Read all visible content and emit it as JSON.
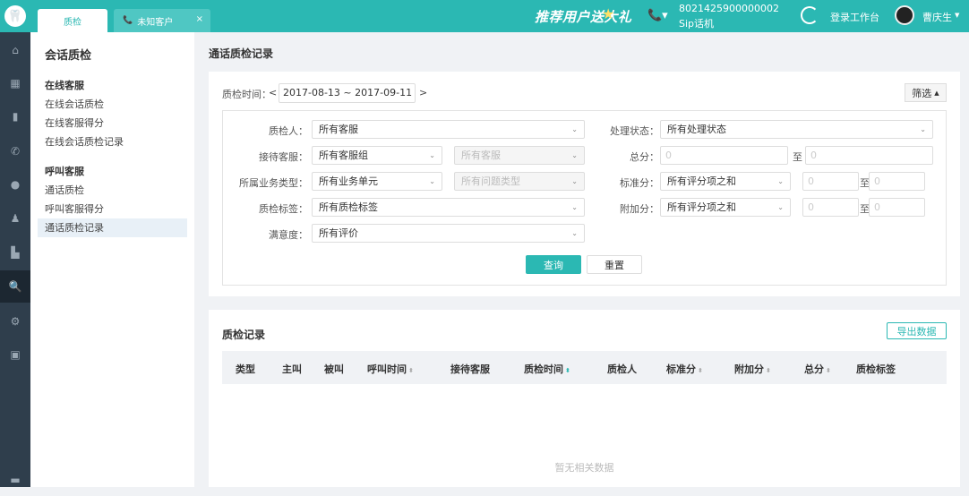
{
  "topbar": {
    "tabs": [
      {
        "label": "质检"
      },
      {
        "label": "未知客户",
        "close": "×"
      }
    ],
    "promo": "推荐用户送大礼",
    "sip_number": "8021425900000002",
    "sip_label": "Sip话机",
    "login_label": "登录工作台",
    "user_name": "曹庆生"
  },
  "subnav": {
    "title": "会话质检",
    "groups": [
      {
        "label": "在线客服",
        "items": [
          "在线会话质检",
          "在线客服得分",
          "在线会话质检记录"
        ]
      },
      {
        "label": "呼叫客服",
        "items": [
          "通话质检",
          "呼叫客服得分",
          "通话质检记录"
        ]
      }
    ]
  },
  "page_title": "通话质检记录",
  "filter": {
    "time_label": "质检时间：",
    "date_range": "2017-08-13 ~ 2017-09-11",
    "prev": "<",
    "next": ">",
    "filter_btn": "筛选",
    "inspector_label": "质检人：",
    "inspector_value": "所有客服",
    "status_label": "处理状态：",
    "status_value": "所有处理状态",
    "agent_label": "接待客服：",
    "agent_group_value": "所有客服组",
    "agent_value": "所有客服",
    "total_label": "总分：",
    "total_from": "0",
    "total_to": "0",
    "to": "至",
    "biz_label": "所属业务类型：",
    "biz_value": "所有业务单元",
    "issue_value": "所有问题类型",
    "std_label": "标准分：",
    "std_value": "所有评分项之和",
    "std_from": "0",
    "std_to": "0",
    "tag_label": "质检标签：",
    "tag_value": "所有质检标签",
    "bonus_label": "附加分：",
    "bonus_value": "所有评分项之和",
    "bonus_from": "0",
    "bonus_to": "0",
    "satisfaction_label": "满意度：",
    "satisfaction_value": "所有评价",
    "query_btn": "查询",
    "reset_btn": "重置"
  },
  "records": {
    "title": "质检记录",
    "export_btn": "导出数据",
    "columns": [
      "类型",
      "主叫",
      "被叫",
      "呼叫时间",
      "接待客服",
      "质检时间",
      "质检人",
      "标准分",
      "附加分",
      "总分",
      "质检标签"
    ],
    "empty": "暂无相关数据"
  },
  "colors": {
    "accent": "#2bb8b3",
    "nav_bg": "#2f3e4c"
  }
}
